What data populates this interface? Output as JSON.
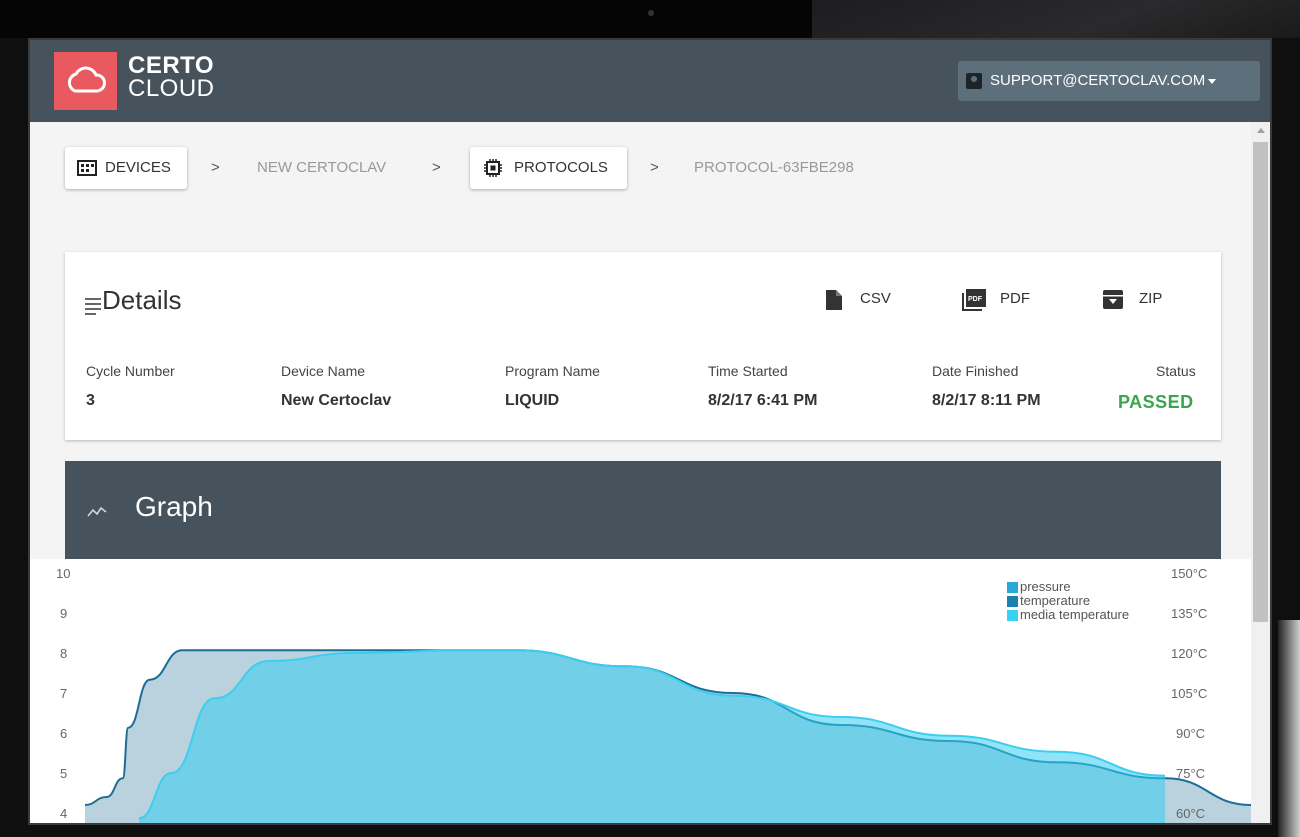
{
  "header": {
    "logo_line1": "CERTO",
    "logo_line2": "CLOUD",
    "user_email": "SUPPORT@CERTOCLAV.COM"
  },
  "breadcrumb": {
    "devices": "DEVICES",
    "device_name": "NEW CERTOCLAV",
    "protocols": "PROTOCOLS",
    "protocol_id": "PROTOCOL-63FBE298",
    "separator": ">"
  },
  "details": {
    "title": "Details",
    "downloads": {
      "csv": "CSV",
      "pdf": "PDF",
      "zip": "ZIP"
    },
    "columns": [
      {
        "label": "Cycle Number",
        "value": "3"
      },
      {
        "label": "Device Name",
        "value": "New Certoclav"
      },
      {
        "label": "Program Name",
        "value": "LIQUID"
      },
      {
        "label": "Time Started",
        "value": "8/2/17 6:41 PM"
      },
      {
        "label": "Date Finished",
        "value": "8/2/17 8:11 PM"
      },
      {
        "label": "Status",
        "value": "PASSED"
      }
    ]
  },
  "graph": {
    "title": "Graph",
    "left_ticks": [
      "10",
      "9",
      "8",
      "7",
      "6",
      "5",
      "4"
    ],
    "right_ticks": [
      "150°C",
      "135°C",
      "120°C",
      "105°C",
      "90°C",
      "75°C",
      "60°C"
    ]
  },
  "chart_data": {
    "type": "area",
    "series": [
      {
        "name": "pressure",
        "color": "#2aa7d9"
      },
      {
        "name": "temperature",
        "color": "#1c7fad"
      },
      {
        "name": "media temperature",
        "color": "#35d2f2"
      }
    ],
    "left_axis_range": [
      4,
      10
    ],
    "right_axis_range": [
      60,
      150
    ],
    "temperature_curve": [
      [
        0.0,
        63
      ],
      [
        0.02,
        66
      ],
      [
        0.035,
        73
      ],
      [
        0.04,
        92
      ],
      [
        0.06,
        110
      ],
      [
        0.09,
        121
      ],
      [
        0.12,
        121
      ],
      [
        0.2,
        121
      ],
      [
        0.3,
        121
      ],
      [
        0.4,
        121
      ],
      [
        0.5,
        115
      ],
      [
        0.6,
        105
      ],
      [
        0.7,
        93
      ],
      [
        0.8,
        87
      ],
      [
        0.9,
        79
      ],
      [
        1.0,
        73
      ],
      [
        1.08,
        63
      ]
    ],
    "media_temperature_curve": [
      [
        0.05,
        58
      ],
      [
        0.08,
        75
      ],
      [
        0.12,
        103
      ],
      [
        0.17,
        117
      ],
      [
        0.25,
        120
      ],
      [
        0.35,
        121
      ],
      [
        0.4,
        121
      ],
      [
        0.5,
        115
      ],
      [
        0.6,
        104
      ],
      [
        0.7,
        96
      ],
      [
        0.8,
        89
      ],
      [
        0.9,
        83
      ],
      [
        1.0,
        74
      ]
    ],
    "grid": false,
    "legend_position": "top-right"
  }
}
